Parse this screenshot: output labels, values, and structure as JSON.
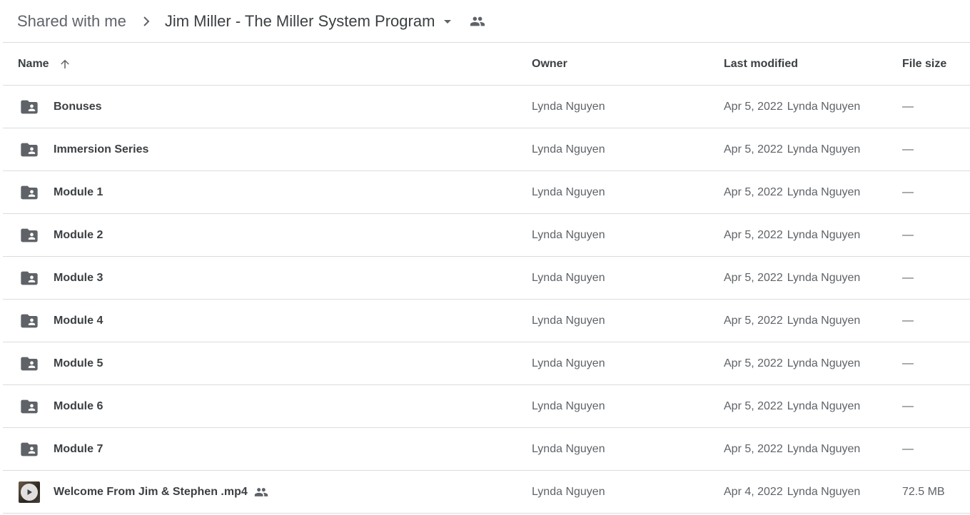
{
  "breadcrumb": {
    "root": "Shared with me",
    "current": "Jim Miller - The Miller System Program"
  },
  "columns": {
    "name": "Name",
    "owner": "Owner",
    "last_modified": "Last modified",
    "file_size": "File size"
  },
  "colors": {
    "text_primary": "#3c4043",
    "text_secondary": "#5f6368",
    "divider": "#dadce0",
    "icon": "#5f6368"
  },
  "rows": [
    {
      "type": "shared-folder-icon",
      "name": "Bonuses",
      "owner": "Lynda Nguyen",
      "modified_date": "Apr 5, 2022",
      "modified_by": "Lynda Nguyen",
      "size": "—"
    },
    {
      "type": "shared-folder-icon",
      "name": "Immersion Series",
      "owner": "Lynda Nguyen",
      "modified_date": "Apr 5, 2022",
      "modified_by": "Lynda Nguyen",
      "size": "—"
    },
    {
      "type": "shared-folder-icon",
      "name": "Module 1",
      "owner": "Lynda Nguyen",
      "modified_date": "Apr 5, 2022",
      "modified_by": "Lynda Nguyen",
      "size": "—"
    },
    {
      "type": "shared-folder-icon",
      "name": "Module 2",
      "owner": "Lynda Nguyen",
      "modified_date": "Apr 5, 2022",
      "modified_by": "Lynda Nguyen",
      "size": "—"
    },
    {
      "type": "shared-folder-icon",
      "name": "Module 3",
      "owner": "Lynda Nguyen",
      "modified_date": "Apr 5, 2022",
      "modified_by": "Lynda Nguyen",
      "size": "—"
    },
    {
      "type": "shared-folder-icon",
      "name": "Module 4",
      "owner": "Lynda Nguyen",
      "modified_date": "Apr 5, 2022",
      "modified_by": "Lynda Nguyen",
      "size": "—"
    },
    {
      "type": "shared-folder-icon",
      "name": "Module 5",
      "owner": "Lynda Nguyen",
      "modified_date": "Apr 5, 2022",
      "modified_by": "Lynda Nguyen",
      "size": "—"
    },
    {
      "type": "shared-folder-icon",
      "name": "Module 6",
      "owner": "Lynda Nguyen",
      "modified_date": "Apr 5, 2022",
      "modified_by": "Lynda Nguyen",
      "size": "—"
    },
    {
      "type": "shared-folder-icon",
      "name": "Module 7",
      "owner": "Lynda Nguyen",
      "modified_date": "Apr 5, 2022",
      "modified_by": "Lynda Nguyen",
      "size": "—"
    },
    {
      "type": "video-thumbnail-icon",
      "name": "Welcome From Jim & Stephen .mp4",
      "owner": "Lynda Nguyen",
      "modified_date": "Apr 4, 2022",
      "modified_by": "Lynda Nguyen",
      "size": "72.5 MB",
      "shared": true
    }
  ]
}
